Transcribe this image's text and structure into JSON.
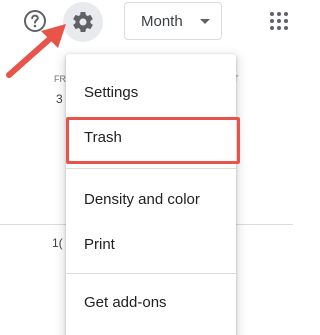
{
  "toolbar": {
    "help_icon": "help-circle-icon",
    "settings_icon": "gear-icon",
    "view_select": {
      "value": "Month"
    },
    "apps_icon": "apps-grid-icon"
  },
  "background": {
    "day_labels": [
      "FR",
      "T"
    ],
    "day_numbers": [
      "3",
      "1("
    ]
  },
  "menu": {
    "items": [
      {
        "label": "Settings"
      },
      {
        "label": "Trash",
        "highlighted": true
      },
      {
        "label": "Density and color"
      },
      {
        "label": "Print"
      },
      {
        "label": "Get add-ons"
      }
    ]
  },
  "colors": {
    "highlight": "#e8534a",
    "arrow": "#e8534a",
    "gear_bg": "#e8eaed"
  }
}
